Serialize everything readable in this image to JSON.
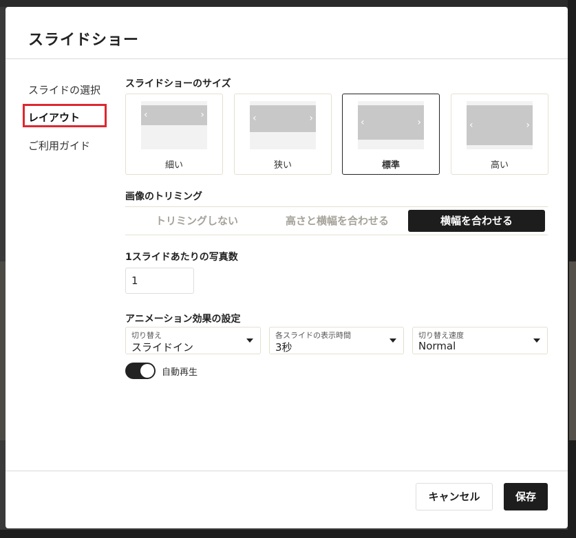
{
  "modal": {
    "title": "スライドショー"
  },
  "sidebar": {
    "items": [
      {
        "label": "スライドの選択"
      },
      {
        "label": "レイアウト"
      },
      {
        "label": "ご利用ガイド"
      }
    ],
    "active_index": 1
  },
  "layout": {
    "size_section": {
      "label": "スライドショーのサイズ",
      "options": [
        {
          "label": "細い"
        },
        {
          "label": "狭い"
        },
        {
          "label": "標準"
        },
        {
          "label": "高い"
        }
      ],
      "selected": "標準"
    },
    "trimming_section": {
      "label": "画像のトリミング",
      "options": [
        {
          "label": "トリミングしない"
        },
        {
          "label": "高さと横幅を合わせる"
        },
        {
          "label": "横幅を合わせる"
        }
      ],
      "selected": "横幅を合わせる"
    },
    "photos_section": {
      "label": "1スライドあたりの写真数",
      "value": "1"
    },
    "animation_section": {
      "label": "アニメーション効果の設定",
      "transition": {
        "caption": "切り替え",
        "value": "スライドイン"
      },
      "duration": {
        "caption": "各スライドの表示時間",
        "value": "3秒"
      },
      "speed": {
        "caption": "切り替え速度",
        "value": "Normal"
      },
      "autoplay": {
        "label": "自動再生",
        "enabled": true
      }
    }
  },
  "footer": {
    "cancel_label": "キャンセル",
    "save_label": "保存"
  },
  "colors": {
    "highlight": "#e0262e",
    "primary": "#1d1d1d",
    "border": "#e3e0d0"
  }
}
